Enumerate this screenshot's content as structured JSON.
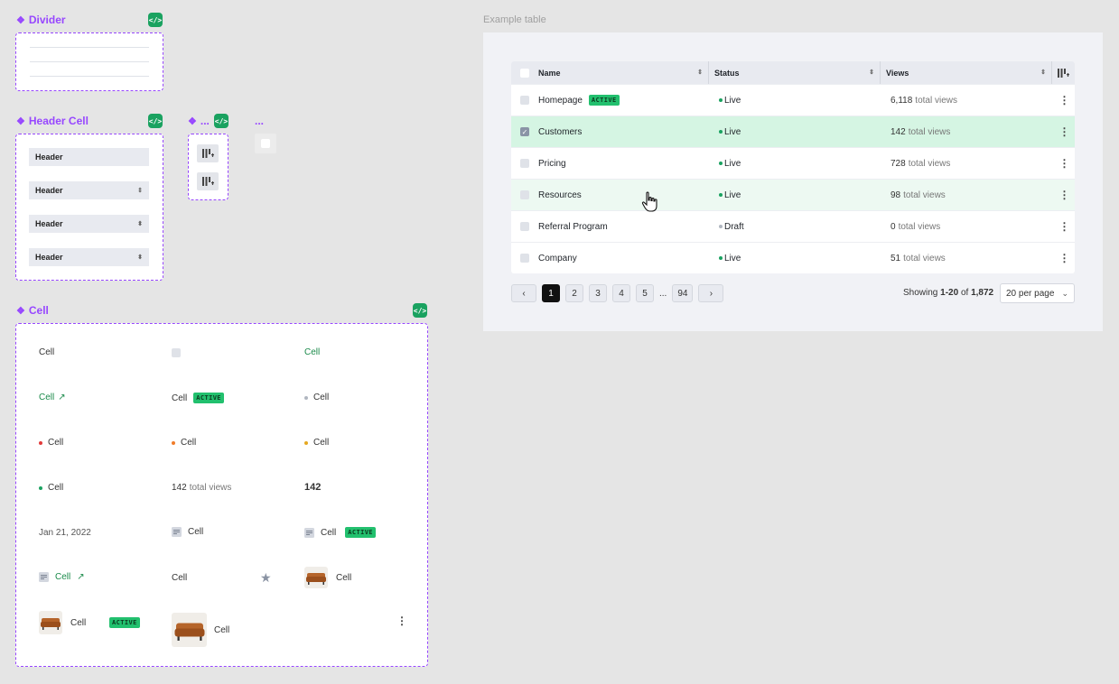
{
  "components": {
    "divider_title": "Divider",
    "header_cell_title": "Header Cell",
    "small_title": "...",
    "small_title2": "...",
    "cell_title": "Cell",
    "code_icon": "</>"
  },
  "header_cells": [
    "Header",
    "Header",
    "Header",
    "Header"
  ],
  "cells": {
    "c1": "Cell",
    "c3": "Cell",
    "link1": "Cell",
    "badge_cell": "Cell",
    "badge": "ACTIVE",
    "grey_dot": "Cell",
    "red_dot": "Cell",
    "orange_dot": "Cell",
    "yellow_dot": "Cell",
    "green_dot": "Cell",
    "views_num": "142",
    "views_txt": "total views",
    "bold_num": "142",
    "date": "Jan 21, 2022",
    "doc_cell": "Cell",
    "doc_badge_cell": "Cell",
    "doc_link": "Cell",
    "star_cell": "Cell",
    "sofa_cell": "Cell",
    "sofa2_cell": "Cell",
    "sofa3_cell": "Cell"
  },
  "example": {
    "label": "Example table",
    "columns": [
      "Name",
      "Status",
      "Views"
    ],
    "rows": [
      {
        "name": "Homepage",
        "badge": "ACTIVE",
        "status": "Live",
        "views": "6,118",
        "views_suffix": "total views"
      },
      {
        "name": "Customers",
        "status": "Live",
        "views": "142",
        "views_suffix": "total views"
      },
      {
        "name": "Pricing",
        "status": "Live",
        "views": "728",
        "views_suffix": "total views"
      },
      {
        "name": "Resources",
        "status": "Live",
        "views": "98",
        "views_suffix": "total views"
      },
      {
        "name": "Referral Program",
        "status": "Draft",
        "views": "0",
        "views_suffix": "total views"
      },
      {
        "name": "Company",
        "status": "Live",
        "views": "51",
        "views_suffix": "total views"
      }
    ],
    "pages": [
      "1",
      "2",
      "3",
      "4",
      "5",
      "...",
      "94"
    ],
    "showing_prefix": "Showing",
    "showing_range": "1-20",
    "showing_of": "of",
    "showing_total": "1,872",
    "per_page": "20 per page"
  },
  "colors": {
    "accent": "#9747ff",
    "live": "#1aa260",
    "draft": "#b0b6c0",
    "selected_row": "#d5f5e3"
  }
}
